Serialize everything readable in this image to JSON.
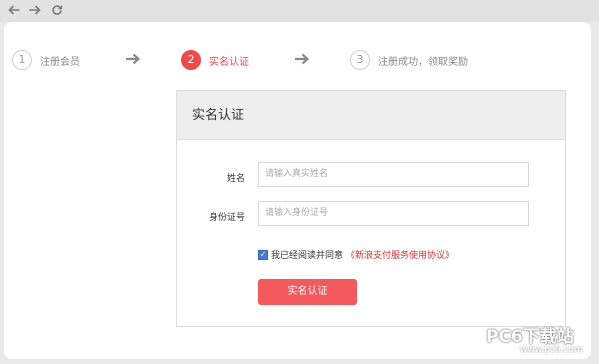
{
  "browser": {
    "back_icon": "arrow-left-icon",
    "forward_icon": "arrow-right-icon",
    "refresh_icon": "refresh-icon"
  },
  "steps": [
    {
      "number": "1",
      "label": "注册会员"
    },
    {
      "number": "2",
      "label": "实名认证"
    },
    {
      "number": "3",
      "label": "注册成功，领取奖励"
    }
  ],
  "active_step": 2,
  "panel": {
    "title": "实名认证",
    "name_label": "姓名",
    "name_placeholder": "请输入真实姓名",
    "id_label": "身份证号",
    "id_placeholder": "请输入身份证号",
    "agree_checked": true,
    "agree_text": "我已经阅读并同意",
    "agree_link": "《新浪支付服务使用协议》",
    "submit_label": "实名认证"
  },
  "watermark": {
    "main": "PC6下载站",
    "sub": "www.pc6.com"
  },
  "colors": {
    "accent": "#f2494b",
    "button": "#f5595b",
    "link": "#e03030"
  }
}
